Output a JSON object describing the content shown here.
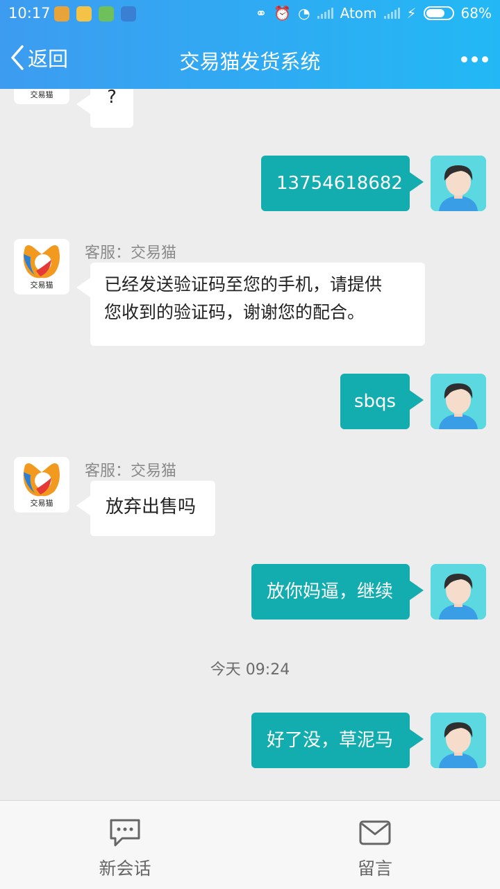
{
  "status_bar": {
    "time": "10:17",
    "carrier": "Atom",
    "battery_percent": "68%",
    "notification_icons": [
      "app-icon-1",
      "app-icon-2",
      "app-icon-3",
      "app-icon-4"
    ]
  },
  "header": {
    "back_label": "返回",
    "title": "交易猫发货系统",
    "more_icon": "more-dots-icon"
  },
  "colors": {
    "header_start": "#3d9cf0",
    "header_end": "#23b8f5",
    "outgoing_bubble": "#14adaf",
    "incoming_bubble": "#ffffff",
    "chat_background": "#ededed"
  },
  "bot": {
    "logo_text": "交易猫"
  },
  "messages": [
    {
      "direction": "in",
      "text": "?"
    },
    {
      "direction": "out",
      "text": "13754618682"
    },
    {
      "direction": "in",
      "sender": "客服：交易猫",
      "lines": [
        "已经发送验证码至您的手机，请提供",
        "您收到的验证码，谢谢您的配合。"
      ]
    },
    {
      "direction": "out",
      "text": "sbqs"
    },
    {
      "direction": "in",
      "sender": "客服：交易猫",
      "text": "放弃出售吗"
    },
    {
      "direction": "out",
      "text": "放你妈逼，继续"
    },
    {
      "direction": "timestamp",
      "text": "今天 09:24"
    },
    {
      "direction": "out",
      "text": "好了没，草泥马"
    }
  ],
  "bottom_bar": {
    "new_chat_label": "新会话",
    "new_chat_icon": "chat-bubble-icon",
    "message_label": "留言",
    "message_icon": "envelope-icon"
  }
}
